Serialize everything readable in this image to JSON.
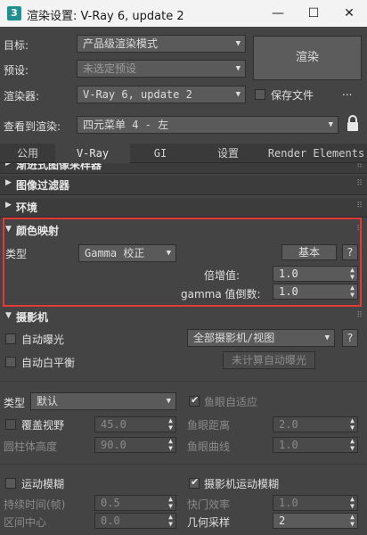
{
  "window": {
    "icon_label": "3",
    "title": "渲染设置: V-Ray 6, update 2",
    "minimize": "—",
    "maximize": "☐",
    "close": "✕"
  },
  "form": {
    "target_label": "目标:",
    "target_value": "产品级渲染模式",
    "preset_label": "预设:",
    "preset_value": "未选定预设",
    "renderer_label": "渲染器:",
    "renderer_value": "V-Ray 6, update 2",
    "save_file_label": "保存文件",
    "more": "...",
    "view_label": "查看到渲染:",
    "view_value": "四元菜单 4 - 左",
    "render_button": "渲染"
  },
  "tabs": [
    "公用",
    "V-Ray",
    "GI",
    "设置",
    "Render Elements"
  ],
  "rollouts": {
    "partial": "渐进式图像采样器",
    "image_filter": "图像过滤器",
    "environment": "环境",
    "color_mapping": "颜色映射",
    "camera": "摄影机"
  },
  "color_mapping": {
    "type_label": "类型",
    "type_value": "Gamma 校正",
    "basic_button": "基本",
    "help_button": "?",
    "multiplier_label": "倍增值:",
    "multiplier_value": "1.0",
    "inverse_gamma_label": "gamma 值倒数:",
    "inverse_gamma_value": "1.0"
  },
  "camera": {
    "auto_exposure": "自动曝光",
    "all_cameras": "全部摄影机/视图",
    "help_button": "?",
    "auto_wb": "自动白平衡",
    "not_calculated": "未计算自动曝光",
    "type_label": "类型",
    "type_value": "默认",
    "fisheye_auto": "鱼眼自适应",
    "override_fov": "覆盖视野",
    "fov_value": "45.0",
    "fisheye_dist": "鱼眼距离",
    "fisheye_dist_value": "2.0",
    "cyl_height": "圆柱体高度",
    "cyl_height_value": "90.0",
    "fisheye_curve": "鱼眼曲线",
    "fisheye_curve_value": "1.0",
    "motion_blur": "运动模糊",
    "camera_motion_blur": "摄影机运动模糊",
    "duration": "持续时间(帧)",
    "duration_value": "0.5",
    "shutter_eff": "快门效率",
    "shutter_eff_value": "1.0",
    "interval_center": "区间中心",
    "interval_center_value": "0.0",
    "geo_samples": "几何采样",
    "geo_samples_value": "2"
  }
}
